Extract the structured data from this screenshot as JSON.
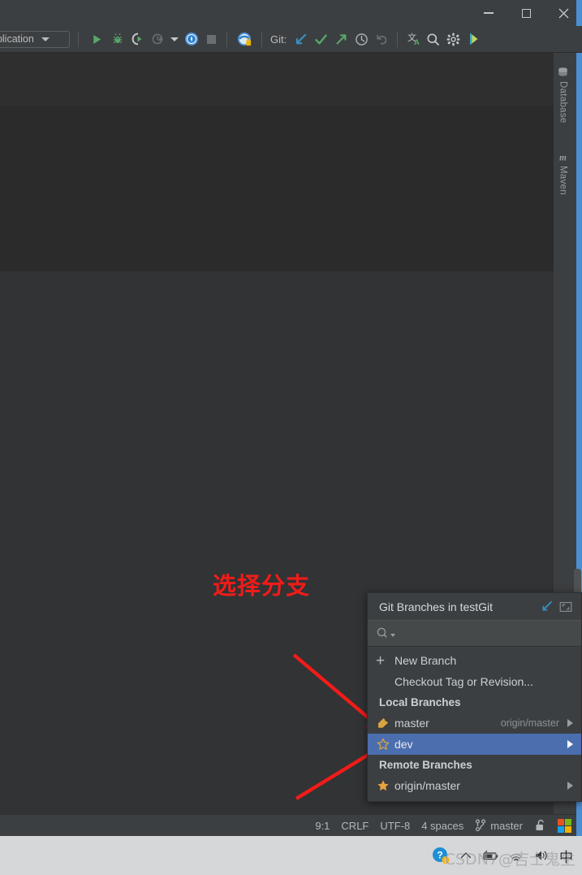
{
  "window": {
    "controls": {
      "minimize": "–",
      "maximize": "□",
      "close": "✕"
    }
  },
  "toolbar": {
    "run_config_label": "pplication",
    "git_label": "Git:",
    "icons": [
      {
        "name": "run-icon",
        "title": "Run"
      },
      {
        "name": "debug-icon",
        "title": "Debug"
      },
      {
        "name": "run-with-coverage-icon",
        "title": "Run with Coverage"
      },
      {
        "name": "profile-icon",
        "title": "Profile"
      },
      {
        "name": "profile-dropdown-caret-icon",
        "title": "Profile options"
      },
      {
        "name": "attach-debugger-icon",
        "title": "Attach to Process"
      },
      {
        "name": "stop-icon",
        "title": "Stop"
      },
      {
        "name": "app-server-icon",
        "title": "Application Server"
      },
      {
        "name": "git-update-project-icon",
        "title": "Update Project"
      },
      {
        "name": "git-commit-icon",
        "title": "Commit"
      },
      {
        "name": "git-push-icon",
        "title": "Push"
      },
      {
        "name": "git-history-icon",
        "title": "History"
      },
      {
        "name": "git-rollback-icon",
        "title": "Rollback"
      },
      {
        "name": "translate-icon",
        "title": "Translate"
      },
      {
        "name": "search-everywhere-icon",
        "title": "Search Everywhere"
      },
      {
        "name": "settings-gear-icon",
        "title": "Settings"
      },
      {
        "name": "plugin-icon",
        "title": "Plugin"
      }
    ]
  },
  "tool_windows": [
    {
      "label": "Database",
      "icon": "database-icon"
    },
    {
      "label": "Maven",
      "icon": "maven-m-icon"
    }
  ],
  "editor": {
    "inspection_status": "ok"
  },
  "annotation": {
    "text": "选择分支",
    "color": "#f01c18"
  },
  "popup": {
    "title": "Git Branches in testGit",
    "title_icons": [
      {
        "name": "popup-pin-icon"
      },
      {
        "name": "popup-restore-icon"
      }
    ],
    "search_placeholder": "",
    "search_value": "",
    "items": [
      {
        "type": "action",
        "label": "New Branch",
        "icon": "plus-icon",
        "sub": "",
        "arrow": false,
        "selected": false
      },
      {
        "type": "action",
        "label": "Checkout Tag or Revision...",
        "icon": "",
        "sub": "",
        "arrow": false,
        "selected": false
      },
      {
        "type": "header",
        "label": "Local Branches",
        "icon": "",
        "sub": "",
        "arrow": false,
        "selected": false
      },
      {
        "type": "branch",
        "label": "master",
        "icon": "tag-icon",
        "sub": "origin/master",
        "arrow": true,
        "selected": false
      },
      {
        "type": "branch",
        "label": "dev",
        "icon": "star-outline-icon",
        "sub": "",
        "arrow": true,
        "selected": true
      },
      {
        "type": "header",
        "label": "Remote Branches",
        "icon": "",
        "sub": "",
        "arrow": false,
        "selected": false
      },
      {
        "type": "branch",
        "label": "origin/master",
        "icon": "star-filled-icon",
        "sub": "",
        "arrow": true,
        "selected": false
      }
    ],
    "selection_color": "#4b6eaf"
  },
  "status_bar": {
    "caret_position": "9:1",
    "line_separator": "CRLF",
    "encoding": "UTF-8",
    "indent": "4 spaces",
    "branch": "master",
    "branch_icon": "git-branch-icon",
    "lock_icon": "unlocked-icon",
    "os_icon": "windows-logo-icon"
  },
  "taskbar": {
    "tray_icons": [
      {
        "name": "help-question-icon"
      },
      {
        "name": "show-hidden-icons-chevron-icon"
      },
      {
        "name": "battery-icon"
      },
      {
        "name": "wifi-icon"
      },
      {
        "name": "volume-icon"
      }
    ],
    "ime_indicator": "中",
    "watermark": "CSDN7@吉士鬼生"
  }
}
